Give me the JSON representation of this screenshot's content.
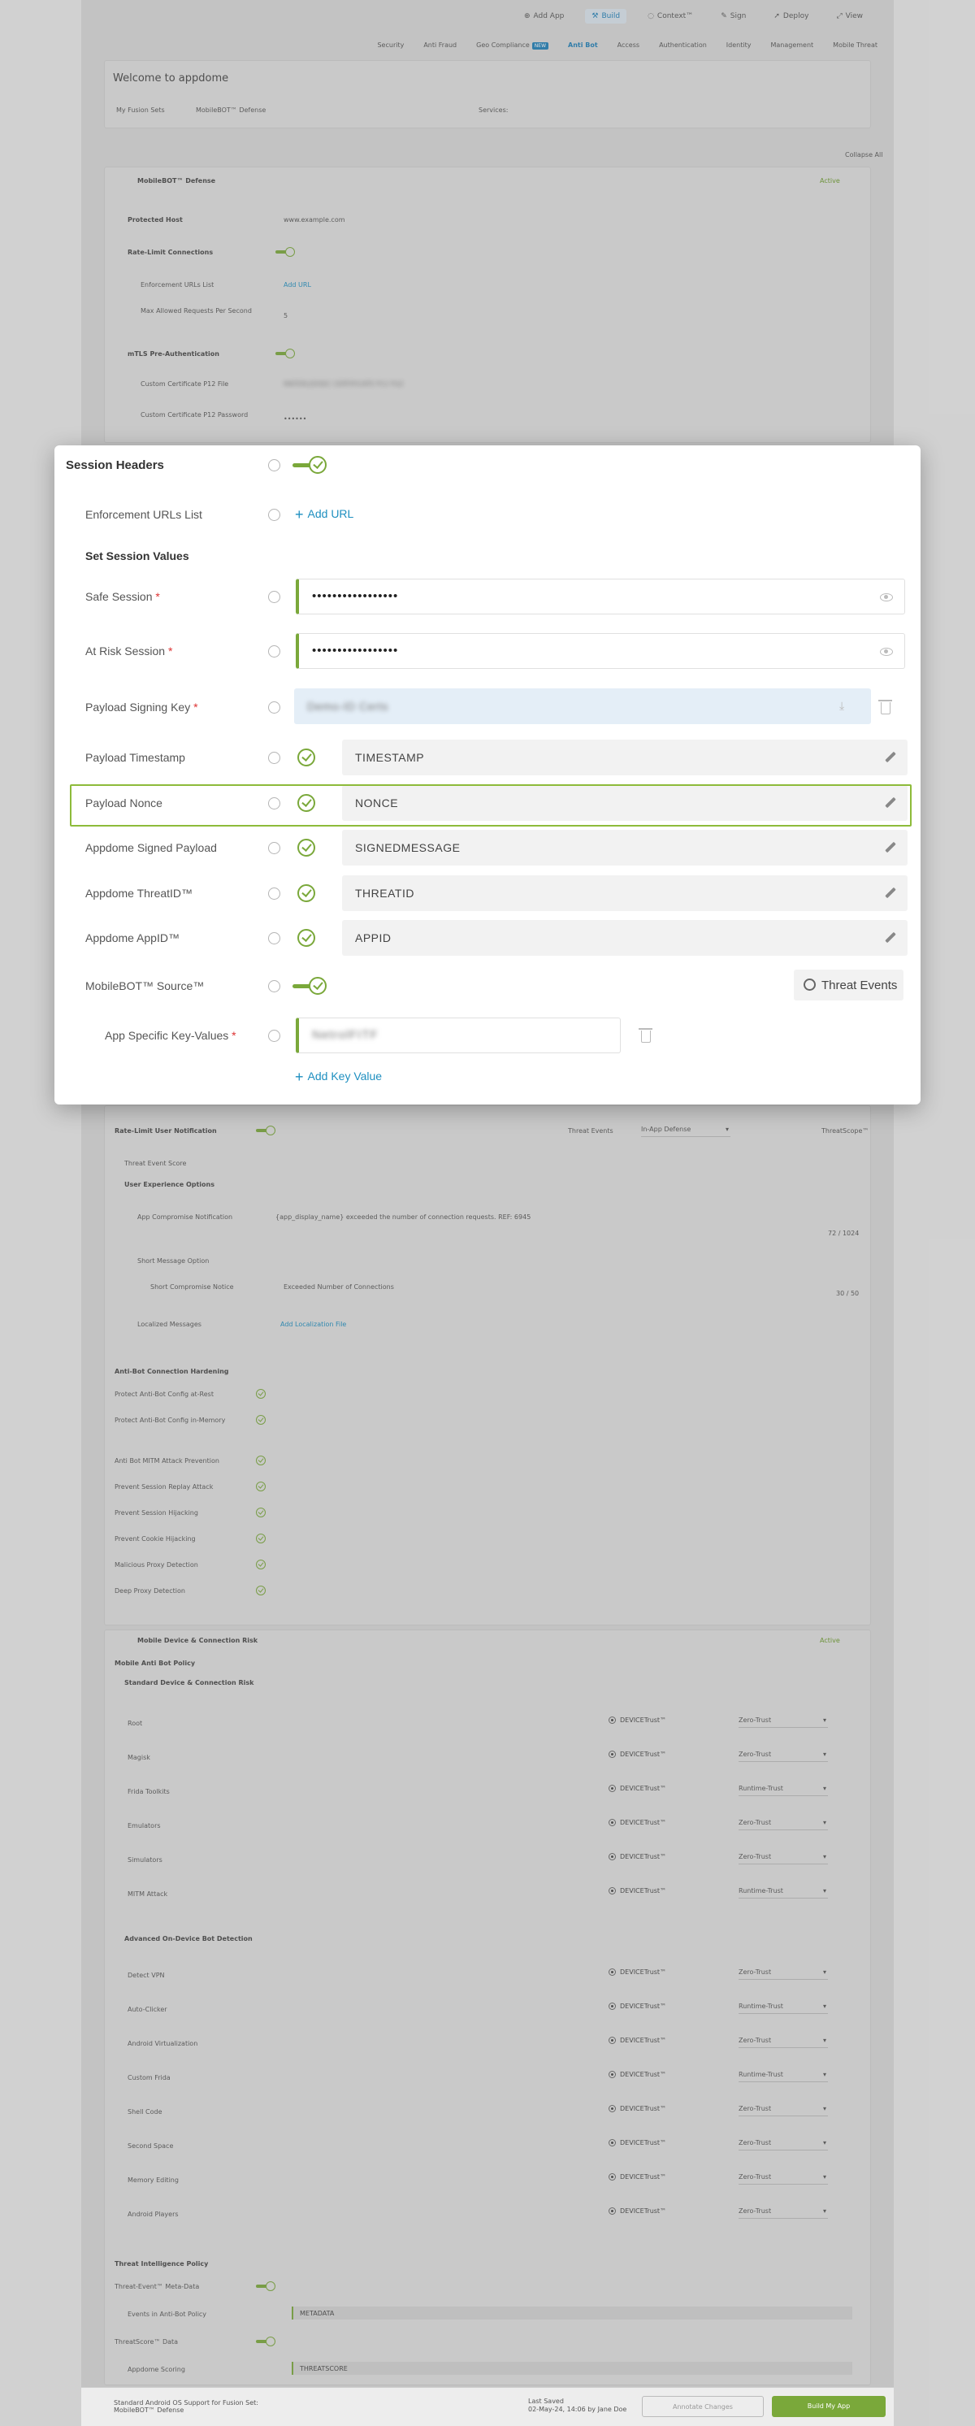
{
  "topbar": {
    "add_app": "Add App",
    "build": "Build",
    "context": "Context™",
    "sign": "Sign",
    "deploy": "Deploy",
    "view": "View"
  },
  "subnav": [
    "Security",
    "Anti Fraud",
    "Geo Compliance",
    "Anti Bot",
    "Access",
    "Authentication",
    "Identity",
    "Management",
    "Mobile Threat"
  ],
  "subnav_badge": "NEW",
  "welcome": {
    "title": "Welcome to appdome",
    "fusion_sets": "My Fusion Sets",
    "defense": "MobileBOT™ Defense",
    "services": "Services:"
  },
  "collapse_all": "Collapse All",
  "bot_section": {
    "title": "MobileBOT™ Defense",
    "status": "Active",
    "protected_host": "Protected Host",
    "host_value": "www.example.com",
    "rate_limit": "Rate-Limit Connections",
    "enforcement": "Enforcement URLs List",
    "add_url": "Add URL",
    "max_req": "Max Allowed Requests Per Second",
    "max_req_value": "5",
    "mtls": "mTLS Pre-Authentication",
    "cert_file": "Custom Certificate P12 File",
    "cert_file_value": "MATERLEDSEC CERTIFICATE P12 FILE",
    "cert_pw": "Custom Certificate P12 Password",
    "cert_pw_value": "••••••"
  },
  "modal": {
    "session_headers": "Session Headers",
    "enforcement": "Enforcement URLs List",
    "add_url": "Add URL",
    "set_session": "Set Session Values",
    "safe_session": "Safe Session",
    "safe_value": "•••••••••••••••••",
    "risk_session": "At Risk Session",
    "risk_value": "•••••••••••••••••",
    "signing_key": "Payload Signing Key",
    "signing_value": "Demo-ID Certs",
    "timestamp": "Payload Timestamp",
    "timestamp_value": "TIMESTAMP",
    "nonce": "Payload Nonce",
    "nonce_value": "NONCE",
    "signed": "Appdome Signed Payload",
    "signed_value": "SIGNEDMESSAGE",
    "threatid": "Appdome ThreatID™",
    "threatid_value": "THREATID",
    "appid": "Appdome AppID™",
    "appid_value": "APPID",
    "source": "MobileBOT™ Source™",
    "threat_events": "Threat Events",
    "kv": "App Specific Key-Values",
    "kv_value": "NetrolFITF",
    "add_kv": "Add Key Value",
    "asterisk": "*"
  },
  "notification": {
    "rate_limit": "Rate-Limit User Notification",
    "threat_events": "Threat Events",
    "in_app": "In-App Defense",
    "threatscope": "ThreatScope™",
    "score": "Threat Event Score",
    "ux": "User Experience Options",
    "compromise": "App Compromise Notification",
    "compromise_value": "{app_display_name} exceeded the number of connection requests. REF: 6945",
    "compromise_count": "72 / 1024",
    "short_opt": "Short Message Option",
    "short_notice": "Short Compromise Notice",
    "short_value": "Exceeded Number of Connections",
    "short_count": "30 / 50",
    "localized": "Localized Messages",
    "add_loc": "Add Localization File"
  },
  "hardening": {
    "title": "Anti-Bot Connection Hardening",
    "items": [
      "Protect Anti-Bot Config at-Rest",
      "Protect Anti-Bot Config in-Memory",
      "Anti Bot MITM Attack Prevention",
      "Prevent Session Replay Attack",
      "Prevent Session Hijacking",
      "Prevent Cookie Hijacking",
      "Malicious Proxy Detection",
      "Deep Proxy Detection"
    ]
  },
  "device": {
    "title": "Mobile Device & Connection Risk",
    "status": "Active",
    "policy": "Mobile Anti Bot Policy",
    "std": "Standard Device & Connection Risk",
    "std_items": [
      {
        "name": "Root",
        "dt": "DEVICETrust™",
        "sel": "Zero-Trust"
      },
      {
        "name": "Magisk",
        "dt": "DEVICETrust™",
        "sel": "Zero-Trust"
      },
      {
        "name": "Frida Toolkits",
        "dt": "DEVICETrust™",
        "sel": "Runtime-Trust"
      },
      {
        "name": "Emulators",
        "dt": "DEVICETrust™",
        "sel": "Zero-Trust"
      },
      {
        "name": "Simulators",
        "dt": "DEVICETrust™",
        "sel": "Zero-Trust"
      },
      {
        "name": "MITM Attack",
        "dt": "DEVICETrust™",
        "sel": "Runtime-Trust"
      }
    ],
    "adv": "Advanced On-Device Bot Detection",
    "adv_items": [
      {
        "name": "Detect VPN",
        "dt": "DEVICETrust™",
        "sel": "Zero-Trust"
      },
      {
        "name": "Auto-Clicker",
        "dt": "DEVICETrust™",
        "sel": "Runtime-Trust"
      },
      {
        "name": "Android Virtualization",
        "dt": "DEVICETrust™",
        "sel": "Zero-Trust"
      },
      {
        "name": "Custom Frida",
        "dt": "DEVICETrust™",
        "sel": "Runtime-Trust"
      },
      {
        "name": "Shell Code",
        "dt": "DEVICETrust™",
        "sel": "Zero-Trust"
      },
      {
        "name": "Second Space",
        "dt": "DEVICETrust™",
        "sel": "Zero-Trust"
      },
      {
        "name": "Memory Editing",
        "dt": "DEVICETrust™",
        "sel": "Zero-Trust"
      },
      {
        "name": "Android Players",
        "dt": "DEVICETrust™",
        "sel": "Zero-Trust"
      }
    ],
    "ti": "Threat Intelligence Policy",
    "meta": "Threat-Event™ Meta-Data",
    "events_policy": "Events in Anti-Bot Policy",
    "events_value": "METADATA",
    "ts": "ThreatScore™ Data",
    "scoring": "Appdome Scoring",
    "scoring_value": "THREATSCORE"
  },
  "footer": {
    "info": "Standard Android OS Support for Fusion Set: MobileBOT™ Defense",
    "last_saved": "Last Saved",
    "saved_by": "02-May-24, 14:06 by Jane Doe",
    "annotate": "Annotate Changes",
    "build": "Build My App"
  }
}
